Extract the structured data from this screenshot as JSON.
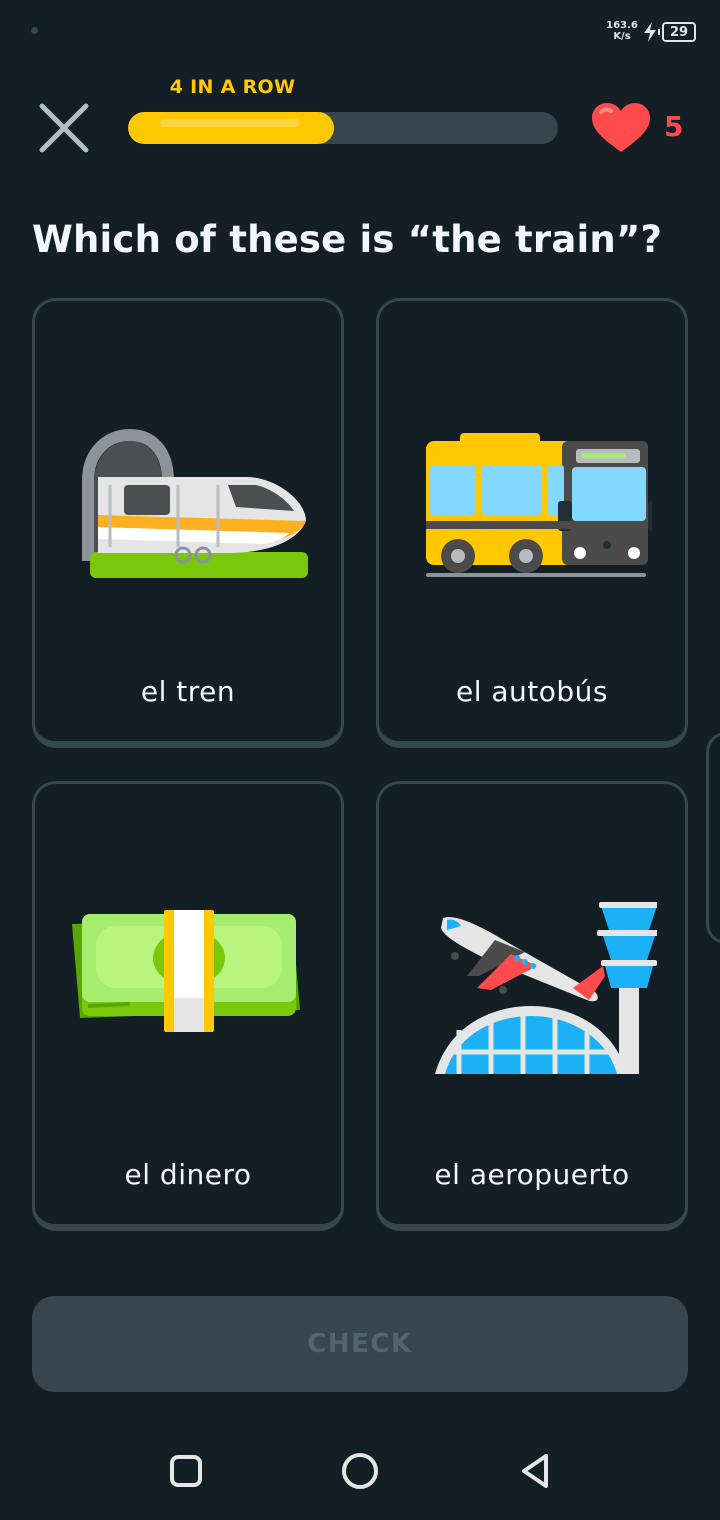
{
  "status_bar": {
    "net_speed_value": "163.6",
    "net_speed_unit": "K/s",
    "battery_level": "29"
  },
  "header": {
    "streak_label": "4 IN A ROW",
    "progress": 0.48,
    "hearts": "5"
  },
  "question": "Which of these is “the train”?",
  "options": [
    {
      "label": "el tren",
      "icon": "train-icon"
    },
    {
      "label": "el autobús",
      "icon": "bus-icon"
    },
    {
      "label": "el dinero",
      "icon": "money-icon"
    },
    {
      "label": "el aeropuerto",
      "icon": "airport-icon"
    }
  ],
  "check_label": "CHECK",
  "colors": {
    "background": "#131f24",
    "card_border": "#37464f",
    "streak": "#ffc800",
    "heart": "#ff4b4b",
    "check_disabled_text": "#52656d"
  }
}
